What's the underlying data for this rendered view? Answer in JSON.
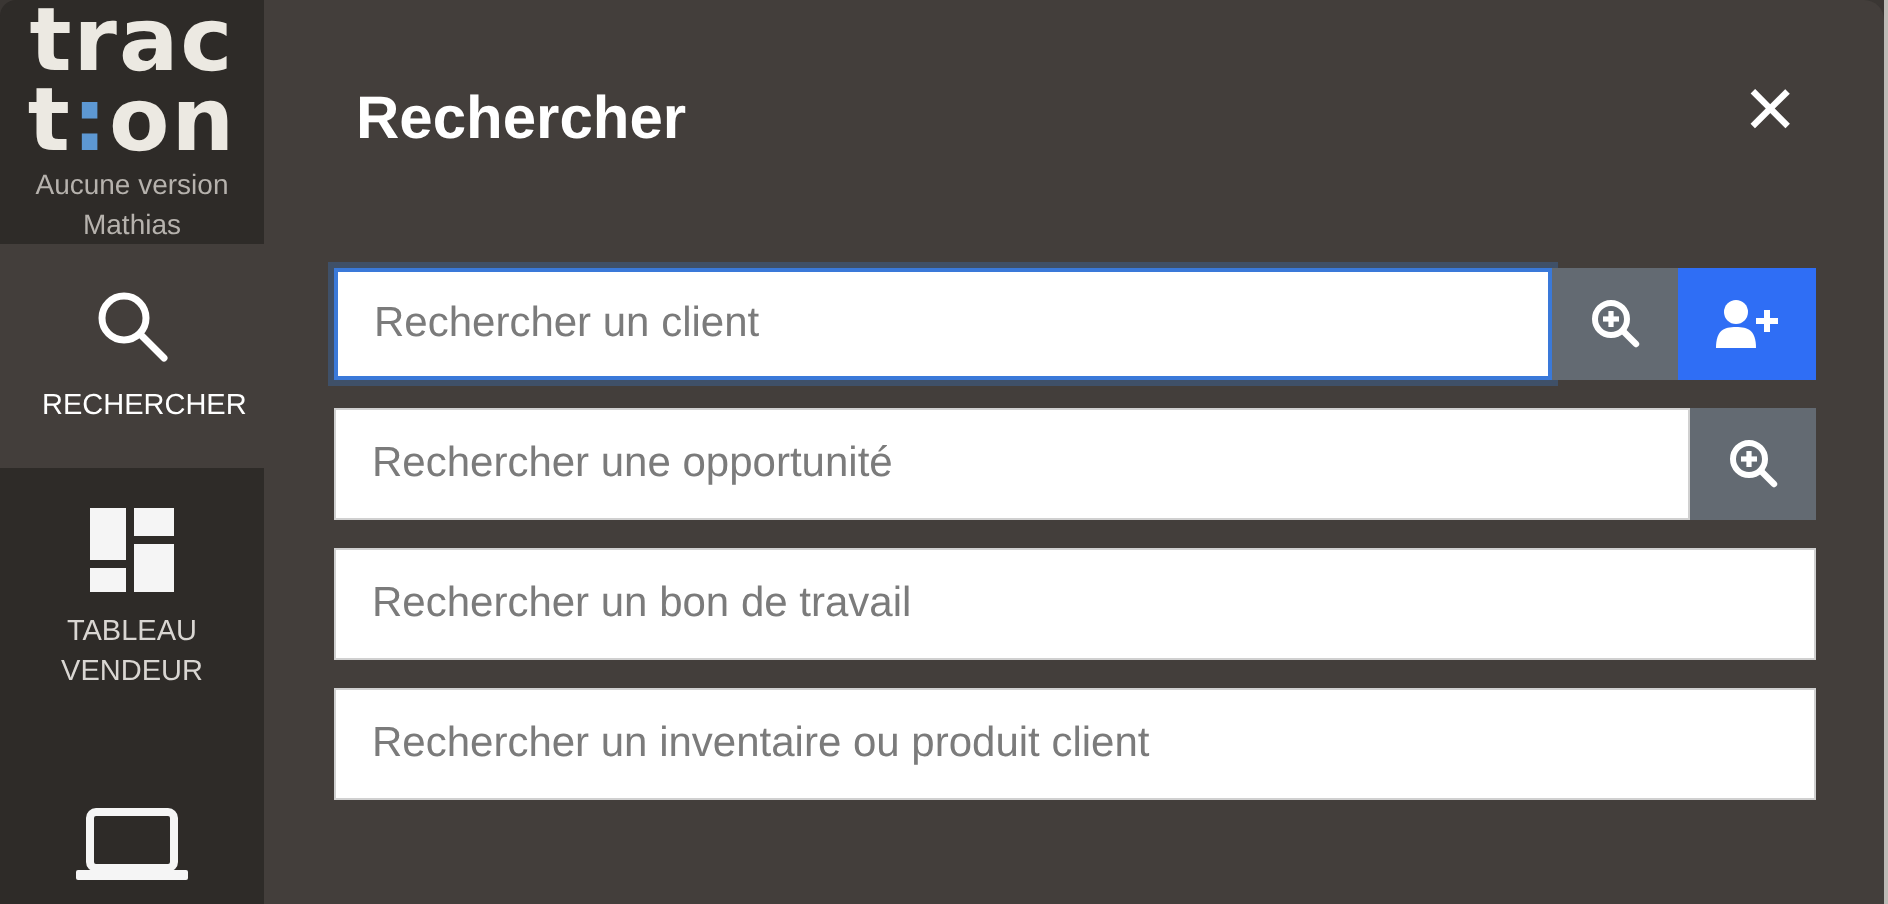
{
  "sidebar": {
    "logo": {
      "top": "trac",
      "bottom_start": "t",
      "bottom_mark": ":",
      "bottom_end": "on"
    },
    "version": "Aucune version",
    "user": "Mathias",
    "items": [
      {
        "kind": "search",
        "label": "RECHERCHER",
        "selected": true
      },
      {
        "kind": "dashboard",
        "label": "TABLEAU VENDEUR",
        "selected": false
      },
      {
        "kind": "laptop",
        "selected": false
      }
    ]
  },
  "panel": {
    "title": "Rechercher",
    "close": "×",
    "fields": [
      {
        "placeholder": "Rechercher un client",
        "focused": true,
        "buttons": [
          {
            "kind": "search"
          },
          {
            "kind": "add-person"
          }
        ]
      },
      {
        "placeholder": "Rechercher une opportunité",
        "focused": false,
        "buttons": [
          {
            "kind": "search"
          }
        ]
      },
      {
        "placeholder": "Rechercher un bon de travail",
        "focused": false
      },
      {
        "placeholder": "Rechercher un inventaire ou produit client",
        "focused": false
      }
    ]
  }
}
